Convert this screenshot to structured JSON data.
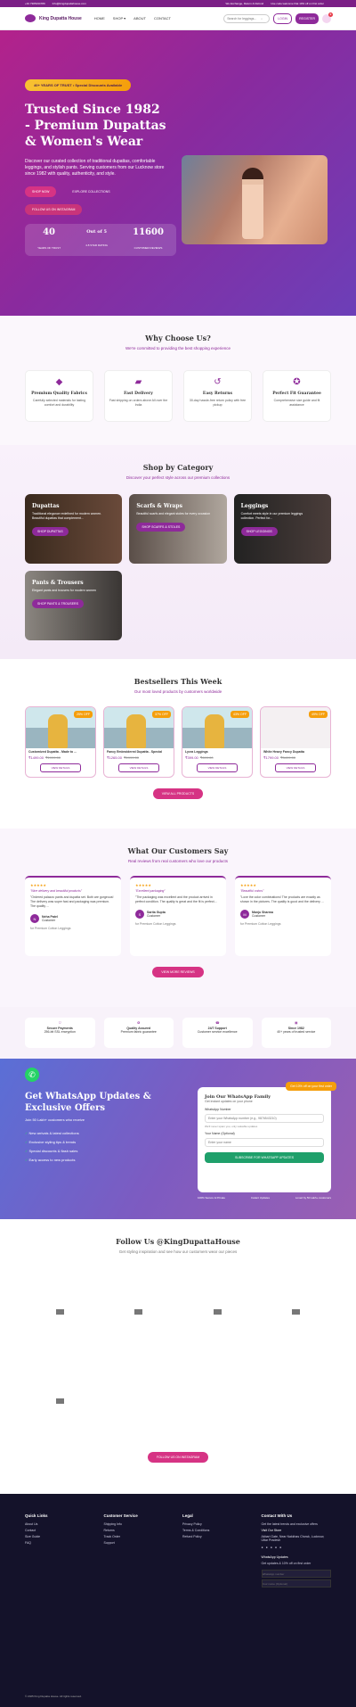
{
  "topbar": {
    "phone": "+91 7905234789",
    "email": "Info@kingdupattahouse.com",
    "shipping": "We Exchange, Return & Refund",
    "offer": "Use code:welcome Flat 10% off on first order"
  },
  "nav": {
    "brand": "King Dupatta House",
    "menu": [
      "HOME",
      "SHOP ▾",
      "ABOUT",
      "CONTACT"
    ],
    "search_placeholder": "Search for leggings...",
    "login": "LOGIN",
    "register": "REGISTER",
    "cart_count": "0"
  },
  "hero": {
    "badge": "40+ YEARS OF TRUST • Special Discounts Available",
    "title": "Trusted Since 1982 - Premium Dupattas & Women's Wear",
    "desc": "Discover our curated collection of traditional dupattas, comfortable leggings, and stylish pants. Serving customers from our Lucknow store since 1982 with quality, authenticity, and style.",
    "shop_btn": "SHOP NOW",
    "explore_btn": "EXPLORE COLLECTIONS",
    "ig_btn": "FOLLOW US ON INSTAGRAM",
    "stats": [
      {
        "v": "40",
        "l": "YEARS OF TRUST"
      },
      {
        "v": "Out of 5",
        "l": "4.8 STAR RATING"
      },
      {
        "v": "11600",
        "l": "CUSTOMER REVIEWS"
      }
    ]
  },
  "why": {
    "title": "Why Choose Us?",
    "sub": "We're committed to providing the best shopping experience",
    "cards": [
      {
        "t": "Premium Quality Fabrics",
        "d": "Carefully selected materials for lasting comfort and durability"
      },
      {
        "t": "Fast Delivery",
        "d": "Fast shipping on orders above All over the India"
      },
      {
        "t": "Easy Returns",
        "d": "30-day hassle-free return policy with free pickup"
      },
      {
        "t": "Perfect Fit Guarantee",
        "d": "Comprehensive size guide and fit assistance"
      }
    ]
  },
  "cats": {
    "title": "Shop by Category",
    "sub": "Discover your perfect style across our premium collections",
    "items": [
      {
        "t": "Dupattas",
        "d": "Traditional elegance redefined for modern women. Beautiful dupattas that complement...",
        "b": "SHOP DUPATTAS"
      },
      {
        "t": "Scarfs & Wraps",
        "d": "Beautiful scarfs and elegant stoles for every occasion",
        "b": "SHOP SCARFS & STOLES"
      },
      {
        "t": "Leggings",
        "d": "Comfort meets style in our premium leggings collection. Perfect for...",
        "b": "SHOP LEGGINGS"
      },
      {
        "t": "Pants & Trousers",
        "d": "Elegant pants and trousers for modern women",
        "b": "SHOP PANTS & TROUSERS"
      }
    ]
  },
  "best": {
    "title": "Bestsellers This Week",
    "sub": "Our most loved products by customers worldwide",
    "items": [
      {
        "n": "Customized Dupatta - Made to ...",
        "p": "₹1499.00",
        "o": "₹1999.00",
        "off": "25% OFF"
      },
      {
        "n": "Fancy Embroidered Dupatta - Special",
        "p": "₹1265.00",
        "o": "₹1999.00",
        "off": "37% OFF"
      },
      {
        "n": "Lycra Leggings",
        "p": "₹399.00",
        "o": "₹699.00",
        "off": "43% OFF"
      },
      {
        "n": "White Heavy Fancy Dupatta",
        "p": "₹1799.00",
        "o": "₹3499.00",
        "off": "49% OFF"
      }
    ],
    "view_details": "VIEW DETAILS",
    "view_all": "VIEW ALL PRODUCTS"
  },
  "testi": {
    "title": "What Our Customers Say",
    "sub": "Real reviews from real customers who love our products",
    "items": [
      {
        "q": "\"Nice delivery and beautiful products\"",
        "t": "\"Ordered palazzo pants and dupatta set. Both are gorgeous! The delivery was super fast and packaging was premium. The quality ...",
        "n": "Neha Patel",
        "r": "Customer",
        "i": "N",
        "p": "for Premium Cotton Leggings"
      },
      {
        "q": "\"Excellent packaging\"",
        "t": "\"The packaging was excellent and the product arrived in perfect condition. The quality is great and the fit is perfect...",
        "n": "Sarita Gupta",
        "r": "Customer",
        "i": "S",
        "p": "for Premium Cotton Leggings"
      },
      {
        "q": "\"Beautiful colors\"",
        "t": "\"Love the color combinations! The products are exactly as shown in the pictures. The quality is good and the delivery ...",
        "n": "Manju Sharma",
        "r": "Customer",
        "i": "M",
        "p": "for Premium Cotton Leggings"
      }
    ],
    "btn": "VIEW MORE REVIEWS"
  },
  "trust": [
    {
      "t": "Secure Payments",
      "d": "256-bit SSL encryption"
    },
    {
      "t": "Quality Assured",
      "d": "Premium fabric guarantee"
    },
    {
      "t": "24/7 Support",
      "d": "Customer service excellence"
    },
    {
      "t": "Since 1982",
      "d": "40+ years of trusted service"
    }
  ],
  "wa": {
    "title": "Get WhatsApp Updates & Exclusive Offers",
    "sub": "Join 50 Lakh+ customers who receive",
    "list": [
      "New arrivals & latest collections",
      "Exclusive styling tips & trends",
      "Special discounts & flash sales",
      "Early access to new products"
    ],
    "box_title": "Join Our WhatsApp Family",
    "box_sub": "Get instant updates on your phone",
    "offer": "Get 10% off on your first order",
    "num_label": "WhatsApp Number",
    "num_ph": "Enter your WhatsApp number (e.g., 9876543210)",
    "note": "We'll never spam you, only valuable updates",
    "name_label": "Your Name (Optional)",
    "name_ph": "Enter your name",
    "btn": "SUBSCRIBE FOR WHATSAPP UPDATES",
    "foot": [
      "100% Secure & Private",
      "Instant Updates",
      "Loved by 50 Lakh+ customers"
    ]
  },
  "ig": {
    "title": "Follow Us @KingDupattaHouse",
    "sub": "Get styling inspiration and see how our customers wear our pieces",
    "btn": "FOLLOW US ON INSTAGRAM"
  },
  "footer": {
    "cols": [
      {
        "t": "Quick Links",
        "l": [
          "About Us",
          "Contact",
          "Size Guide",
          "FAQ"
        ]
      },
      {
        "t": "Customer Service",
        "l": [
          "Shipping Info",
          "Returns",
          "Track Order",
          "Support"
        ]
      },
      {
        "t": "Legal",
        "l": [
          "Privacy Policy",
          "Terms & Conditions",
          "Refund Policy"
        ]
      },
      {
        "t": "Contact With Us",
        "l": [
          "Get the latest trends and exclusive offers",
          "Visit Our Store",
          "Akbari Gate, Near Nakkhas Chowk, Lucknow, Uttar Pradesh",
          "WhatsApp Updates",
          "Get updates & 10% off on first order",
          "WhatsApp number",
          "Your name (Optional)"
        ]
      }
    ],
    "copy": "© 2025 King Dupatta House. All rights reserved."
  }
}
